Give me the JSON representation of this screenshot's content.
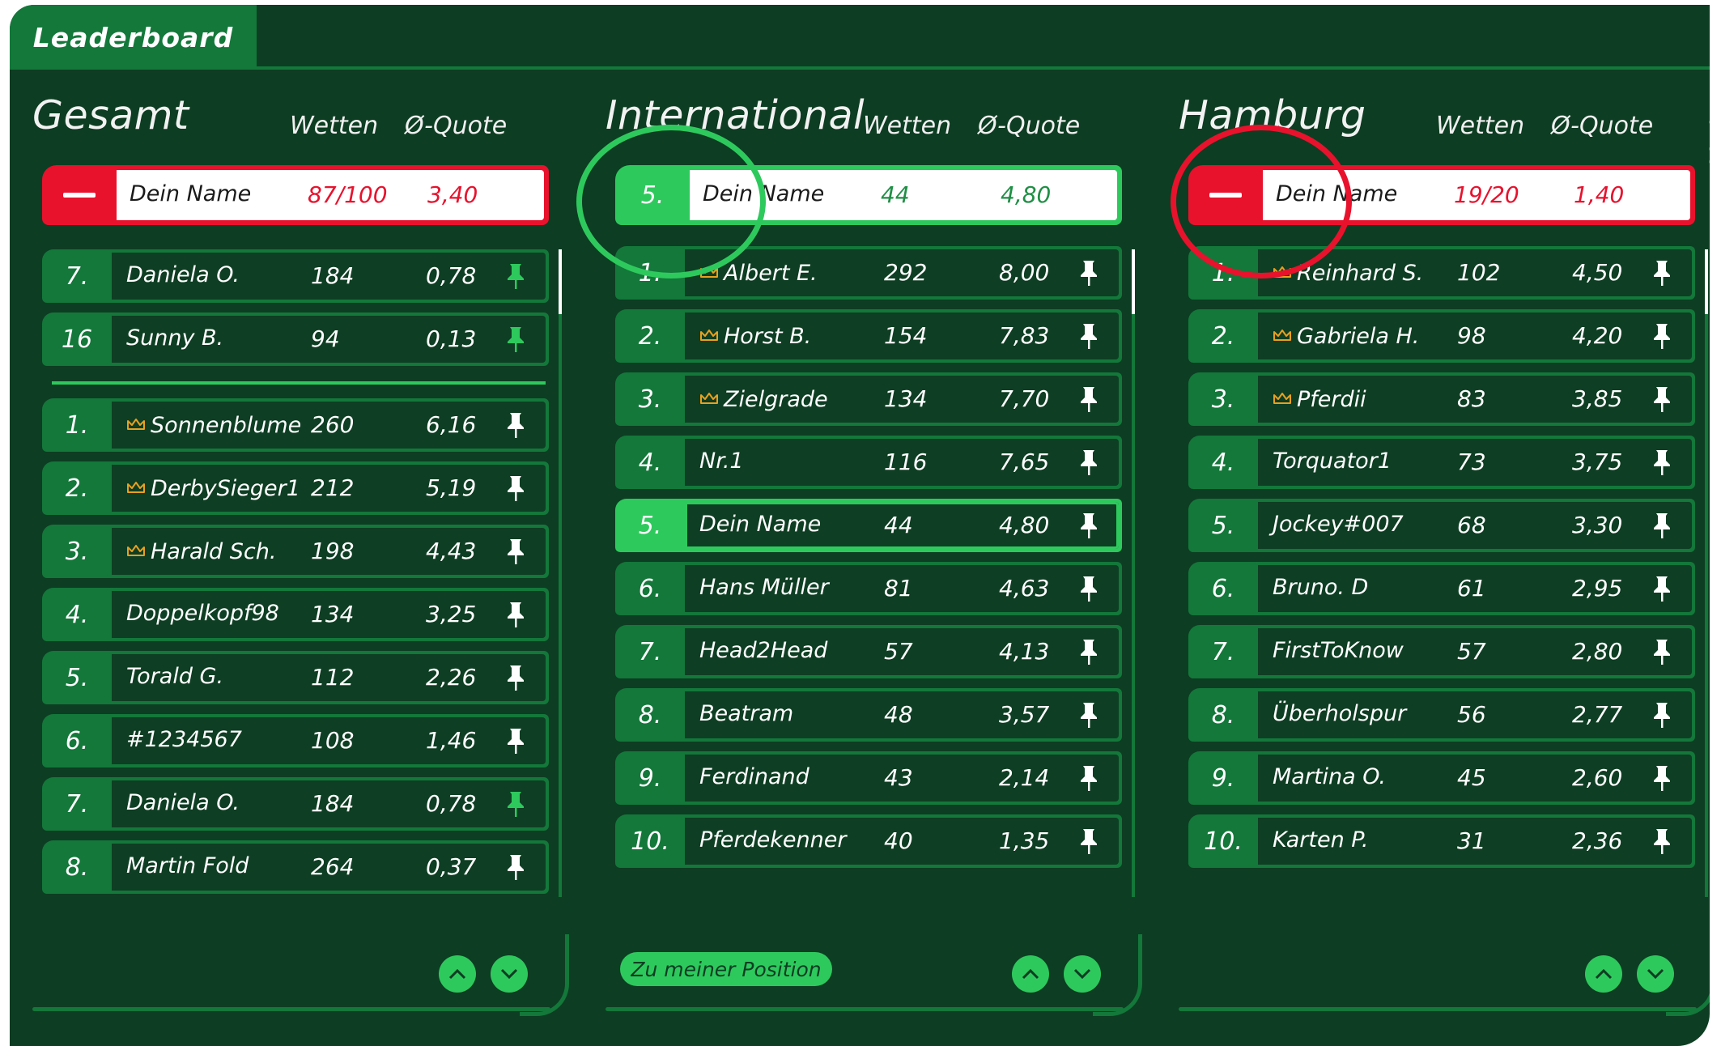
{
  "app": {
    "tab_label": "Leaderboard"
  },
  "colors": {
    "background": "#0d3d22",
    "accent_green": "#2ec95d",
    "row_green": "#13783a",
    "highlight_red": "#e8122d",
    "crown_gold": "#e8a020"
  },
  "columns": {
    "bets": "Wetten",
    "avg_odds": "Ø-Quote"
  },
  "panels": {
    "gesamt": {
      "title": "Gesamt",
      "my_entry": {
        "rank": "",
        "name": "Dein Name",
        "bets": "87/100",
        "odds": "3,40"
      },
      "pinned": [
        {
          "rank": "7.",
          "name": "Daniela O.",
          "bets": "184",
          "odds": "0,78",
          "crown": false,
          "pinned": true
        },
        {
          "rank": "16",
          "name": "Sunny B.",
          "bets": "94",
          "odds": "0,13",
          "crown": false,
          "pinned": true
        }
      ],
      "rows": [
        {
          "rank": "1.",
          "name": "Sonnenblume",
          "bets": "260",
          "odds": "6,16",
          "crown": true,
          "pinned": false
        },
        {
          "rank": "2.",
          "name": "DerbySieger1",
          "bets": "212",
          "odds": "5,19",
          "crown": true,
          "pinned": false
        },
        {
          "rank": "3.",
          "name": "Harald Sch.",
          "bets": "198",
          "odds": "4,43",
          "crown": true,
          "pinned": false
        },
        {
          "rank": "4.",
          "name": "Doppelkopf98",
          "bets": "134",
          "odds": "3,25",
          "crown": false,
          "pinned": false
        },
        {
          "rank": "5.",
          "name": "Torald G.",
          "bets": "112",
          "odds": "2,26",
          "crown": false,
          "pinned": false
        },
        {
          "rank": "6.",
          "name": "#1234567",
          "bets": "108",
          "odds": "1,46",
          "crown": false,
          "pinned": false
        },
        {
          "rank": "7.",
          "name": "Daniela O.",
          "bets": "184",
          "odds": "0,78",
          "crown": false,
          "pinned": true
        },
        {
          "rank": "8.",
          "name": "Martin Fold",
          "bets": "264",
          "odds": "0,37",
          "crown": false,
          "pinned": false
        }
      ]
    },
    "international": {
      "title": "International",
      "my_entry": {
        "rank": "5.",
        "name": "Dein Name",
        "bets": "44",
        "odds": "4,80"
      },
      "position_button": "Zu meiner Position",
      "rows": [
        {
          "rank": "1.",
          "name": "Albert E.",
          "bets": "292",
          "odds": "8,00",
          "crown": true
        },
        {
          "rank": "2.",
          "name": "Horst B.",
          "bets": "154",
          "odds": "7,83",
          "crown": true
        },
        {
          "rank": "3.",
          "name": "Zielgrade",
          "bets": "134",
          "odds": "7,70",
          "crown": true
        },
        {
          "rank": "4.",
          "name": "Nr.1",
          "bets": "116",
          "odds": "7,65",
          "crown": false
        },
        {
          "rank": "5.",
          "name": "Dein Name",
          "bets": "44",
          "odds": "4,80",
          "crown": false,
          "highlight": true
        },
        {
          "rank": "6.",
          "name": "Hans Müller",
          "bets": "81",
          "odds": "4,63",
          "crown": false
        },
        {
          "rank": "7.",
          "name": "Head2Head",
          "bets": "57",
          "odds": "4,13",
          "crown": false
        },
        {
          "rank": "8.",
          "name": "Beatram",
          "bets": "48",
          "odds": "3,57",
          "crown": false
        },
        {
          "rank": "9.",
          "name": "Ferdinand",
          "bets": "43",
          "odds": "2,14",
          "crown": false
        },
        {
          "rank": "10.",
          "name": "Pferdekenner",
          "bets": "40",
          "odds": "1,35",
          "crown": false
        }
      ]
    },
    "hamburg": {
      "title": "Hamburg",
      "my_entry": {
        "rank": "",
        "name": "Dein Name",
        "bets": "19/20",
        "odds": "1,40"
      },
      "carets": "< >",
      "rows": [
        {
          "rank": "1.",
          "name": "Reinhard S.",
          "bets": "102",
          "odds": "4,50",
          "crown": true
        },
        {
          "rank": "2.",
          "name": "Gabriela H.",
          "bets": "98",
          "odds": "4,20",
          "crown": true
        },
        {
          "rank": "3.",
          "name": "Pferdii",
          "bets": "83",
          "odds": "3,85",
          "crown": true
        },
        {
          "rank": "4.",
          "name": "Torquator1",
          "bets": "73",
          "odds": "3,75",
          "crown": false
        },
        {
          "rank": "5.",
          "name": "Jockey#007",
          "bets": "68",
          "odds": "3,30",
          "crown": false
        },
        {
          "rank": "6.",
          "name": "Bruno. D",
          "bets": "61",
          "odds": "2,95",
          "crown": false
        },
        {
          "rank": "7.",
          "name": "FirstToKnow",
          "bets": "57",
          "odds": "2,80",
          "crown": false
        },
        {
          "rank": "8.",
          "name": "Überholspur",
          "bets": "56",
          "odds": "2,77",
          "crown": false
        },
        {
          "rank": "9.",
          "name": "Martina O.",
          "bets": "45",
          "odds": "2,60",
          "crown": false
        },
        {
          "rank": "10.",
          "name": "Karten P.",
          "bets": "31",
          "odds": "2,36",
          "crown": false
        }
      ]
    }
  }
}
